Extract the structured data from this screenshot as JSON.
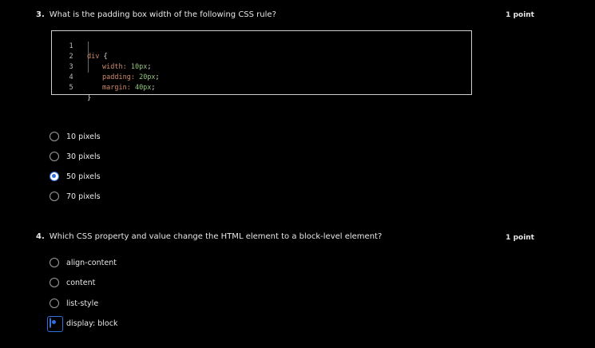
{
  "q3": {
    "number": "3.",
    "text": "What is the padding box width of the following CSS rule?",
    "points": "1 point",
    "code": {
      "line_numbers": [
        "1",
        "2",
        "3",
        "4",
        "5"
      ],
      "line1_selector": "div",
      "line1_brace": " {",
      "line2_prop": "width:",
      "line2_val": " 10px",
      "line2_semi": ";",
      "line3_prop": "padding:",
      "line3_val": " 20px",
      "line3_semi": ";",
      "line4_prop": "margin:",
      "line4_val": " 40px",
      "line4_semi": ";",
      "line5_brace": "}"
    },
    "options": [
      {
        "label": "10 pixels",
        "checked": false
      },
      {
        "label": "30 pixels",
        "checked": false
      },
      {
        "label": "50 pixels",
        "checked": true
      },
      {
        "label": "70 pixels",
        "checked": false
      }
    ]
  },
  "q4": {
    "number": "4.",
    "text": "Which CSS property and value change the HTML element to a block-level element?",
    "points": "1 point",
    "options": [
      {
        "label": "align-content",
        "checked": false
      },
      {
        "label": "content",
        "checked": false
      },
      {
        "label": "list-style",
        "checked": false
      },
      {
        "label": "display: block",
        "checked": true
      }
    ]
  },
  "colors": {
    "accent": "#2f6fe0",
    "background": "#000000"
  }
}
